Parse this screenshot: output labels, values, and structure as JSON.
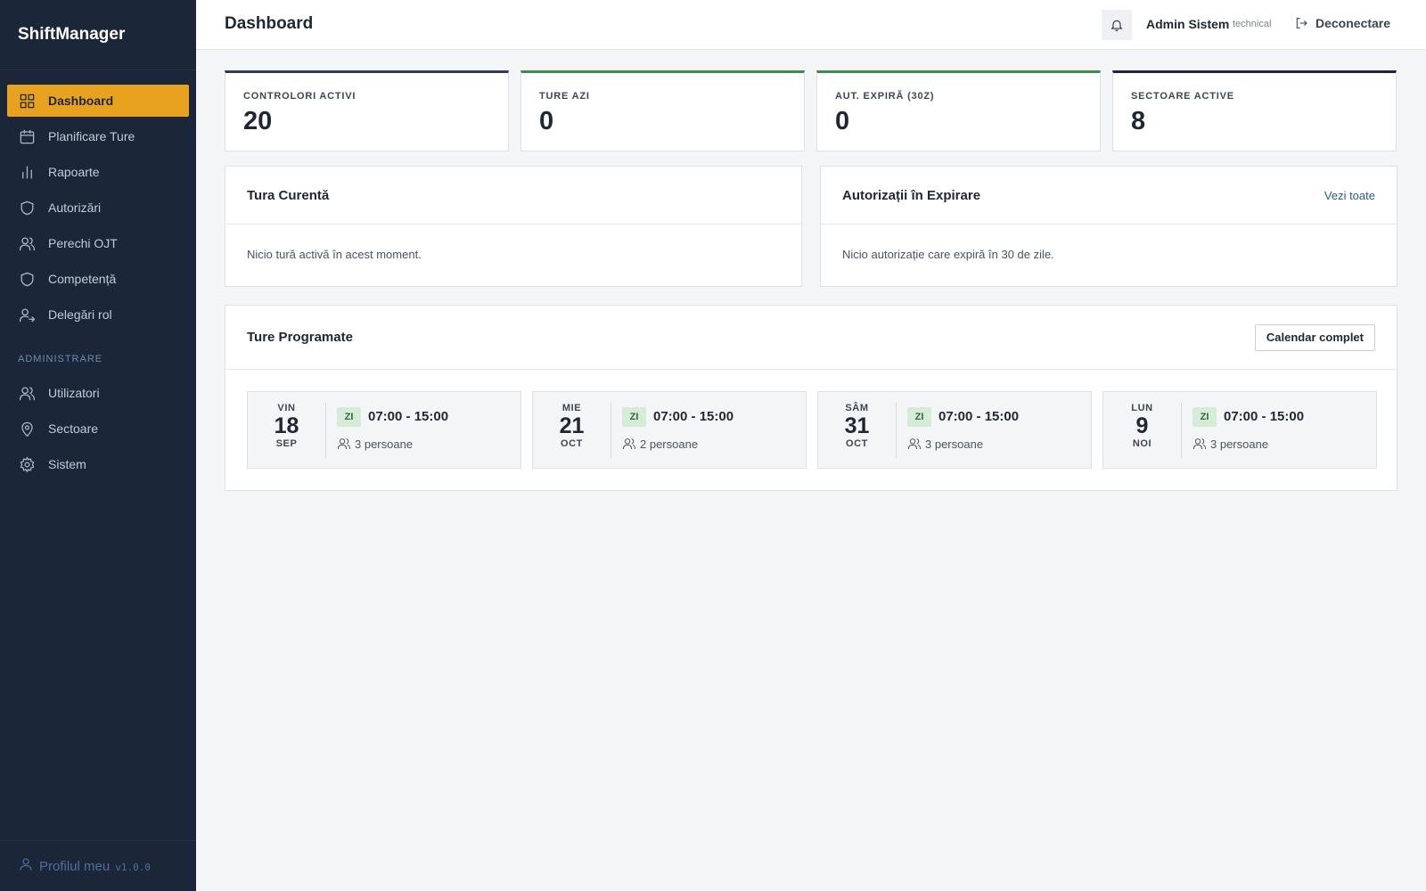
{
  "app": {
    "name": "ShiftManager"
  },
  "sidebar": {
    "items": [
      {
        "label": "Dashboard",
        "icon": "grid-icon"
      },
      {
        "label": "Planificare Ture",
        "icon": "calendar-icon"
      },
      {
        "label": "Rapoarte",
        "icon": "bar-chart-icon"
      },
      {
        "label": "Autorizări",
        "icon": "shield-icon"
      },
      {
        "label": "Perechi OJT",
        "icon": "users-icon"
      },
      {
        "label": "Competență",
        "icon": "shield-icon"
      },
      {
        "label": "Delegări rol",
        "icon": "user-arrow-icon"
      }
    ],
    "section_label": "ADMINISTRARE",
    "admin_items": [
      {
        "label": "Utilizatori",
        "icon": "users-icon"
      },
      {
        "label": "Sectoare",
        "icon": "map-pin-icon"
      },
      {
        "label": "Sistem",
        "icon": "gear-icon"
      }
    ],
    "footer": {
      "profile_label": "Profilul meu",
      "version": "v1.0.0"
    }
  },
  "header": {
    "title": "Dashboard",
    "user_name": "Admin Sistem",
    "user_role": "technical",
    "logout_label": "Deconectare"
  },
  "stats": [
    {
      "label": "CONTROLORI ACTIVI",
      "value": "20",
      "accent": "#2d3b55"
    },
    {
      "label": "TURE AZI",
      "value": "0",
      "accent": "#3f8a4e"
    },
    {
      "label": "AUT. EXPIRĂ (30Z)",
      "value": "0",
      "accent": "#3f8a4e"
    },
    {
      "label": "SECTOARE ACTIVE",
      "value": "8",
      "accent": "#1b2638"
    }
  ],
  "current_shift": {
    "title": "Tura Curentă",
    "empty_text": "Nicio tură activă în acest moment."
  },
  "expiring": {
    "title": "Autorizații în Expirare",
    "link_label": "Vezi toate",
    "empty_text": "Nicio autorizație care expiră în 30 de zile."
  },
  "scheduled": {
    "title": "Ture Programate",
    "button_label": "Calendar complet",
    "shifts": [
      {
        "dow": "VIN",
        "day": "18",
        "month": "SEP",
        "badge": "ZI",
        "time": "07:00 - 15:00",
        "people": "3 persoane"
      },
      {
        "dow": "MIE",
        "day": "21",
        "month": "OCT",
        "badge": "ZI",
        "time": "07:00 - 15:00",
        "people": "2 persoane"
      },
      {
        "dow": "SÂM",
        "day": "31",
        "month": "OCT",
        "badge": "ZI",
        "time": "07:00 - 15:00",
        "people": "3 persoane"
      },
      {
        "dow": "LUN",
        "day": "9",
        "month": "NOI",
        "badge": "ZI",
        "time": "07:00 - 15:00",
        "people": "3 persoane"
      }
    ]
  },
  "colors": {
    "sidebar_bg": "#1b2638",
    "accent": "#e8a220",
    "link": "#2c5a8f"
  }
}
